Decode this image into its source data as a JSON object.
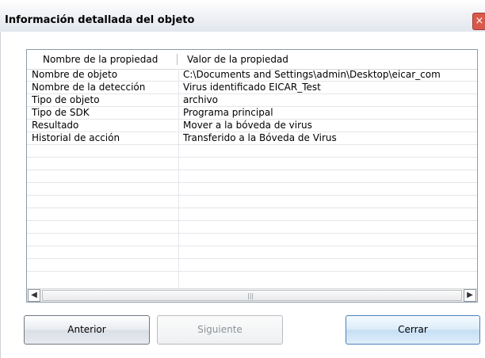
{
  "window": {
    "title": "Información detallada del objeto",
    "close_glyph": "×"
  },
  "table": {
    "columns": [
      "Nombre de la propiedad",
      "Valor de la propiedad"
    ],
    "rows": [
      [
        "Nombre de objeto",
        "C:\\Documents and Settings\\admin\\Desktop\\eicar_com"
      ],
      [
        "Nombre de la detección",
        "Virus identificado EICAR_Test"
      ],
      [
        "Tipo de objeto",
        "archivo"
      ],
      [
        "Tipo de SDK",
        "Programa principal"
      ],
      [
        "Resultado",
        "Mover a la bóveda de virus"
      ],
      [
        "Historial de acción",
        "Transferido a la Bóveda de Virus"
      ]
    ],
    "empty_rows": 10
  },
  "scrollbar": {
    "left_glyph": "◀",
    "right_glyph": "▶",
    "grip_glyph": "|||"
  },
  "buttons": {
    "previous": "Anterior",
    "next": "Siguiente",
    "close": "Cerrar"
  },
  "colors": {
    "close_button": "#d9584c",
    "primary_button_border": "#4a80bd"
  }
}
